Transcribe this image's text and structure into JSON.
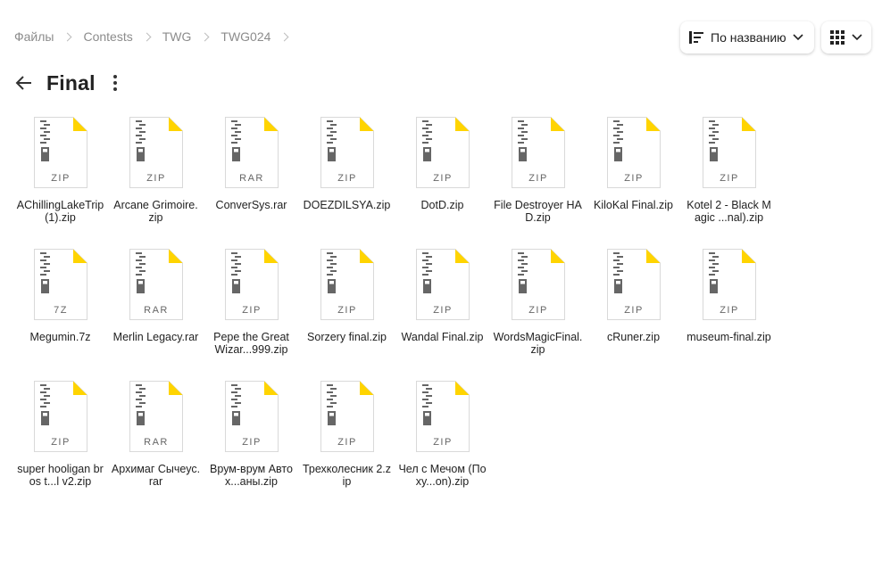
{
  "breadcrumb": [
    "Файлы",
    "Contests",
    "TWG",
    "TWG024"
  ],
  "sort": {
    "label": "По названию"
  },
  "folder": {
    "title": "Final"
  },
  "colors": {
    "zip_accent": "#ffd400",
    "icon_border": "#d9d9d9",
    "zipper": "#666666"
  },
  "files": [
    {
      "name": "AChillingLakeTrip (1).zip",
      "ext": "ZIP"
    },
    {
      "name": "Arcane Grimoire.zip",
      "ext": "ZIP"
    },
    {
      "name": "ConverSys.rar",
      "ext": "RAR"
    },
    {
      "name": "DOEZDILSYA.zip",
      "ext": "ZIP"
    },
    {
      "name": "DotD.zip",
      "ext": "ZIP"
    },
    {
      "name": "File Destroyer HAD.zip",
      "ext": "ZIP"
    },
    {
      "name": "KiloKal Final.zip",
      "ext": "ZIP"
    },
    {
      "name": "Kotel 2 - Black Magic ...nal).zip",
      "ext": "ZIP"
    },
    {
      "name": "Megumin.7z",
      "ext": "7Z"
    },
    {
      "name": "Merlin Legacy.rar",
      "ext": "RAR"
    },
    {
      "name": "Pepe the Great Wizar...999.zip",
      "ext": "ZIP"
    },
    {
      "name": "Sorzery final.zip",
      "ext": "ZIP"
    },
    {
      "name": "Wandal Final.zip",
      "ext": "ZIP"
    },
    {
      "name": "WordsMagicFinal.zip",
      "ext": "ZIP"
    },
    {
      "name": "cRuner.zip",
      "ext": "ZIP"
    },
    {
      "name": "museum-final.zip",
      "ext": "ZIP"
    },
    {
      "name": "super hooligan bros t...l v2.zip",
      "ext": "ZIP"
    },
    {
      "name": "Архимаг Сычеус.rar",
      "ext": "RAR"
    },
    {
      "name": "Врум-врум Автох...аны.zip",
      "ext": "ZIP"
    },
    {
      "name": "Трехколесник 2.zip",
      "ext": "ZIP"
    },
    {
      "name": "Чел с Мечом (Похy...on).zip",
      "ext": "ZIP"
    }
  ]
}
